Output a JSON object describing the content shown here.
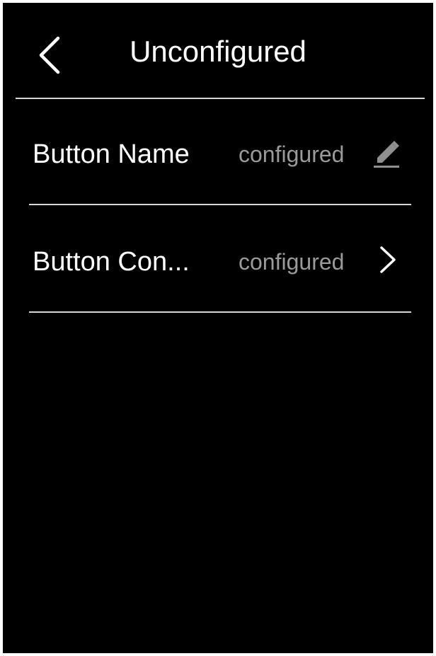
{
  "header": {
    "title": "Unconfigured",
    "back_icon": "chevron-left-icon"
  },
  "rows": [
    {
      "label": "Button Name",
      "value": "configured",
      "icon": "pencil-icon"
    },
    {
      "label": "Button Con...",
      "value": "configured",
      "icon": "chevron-right-icon"
    }
  ],
  "colors": {
    "background": "#000000",
    "primary_text": "#ffffff",
    "secondary_text": "#9a9a9a",
    "divider": "#d8d8d8"
  }
}
